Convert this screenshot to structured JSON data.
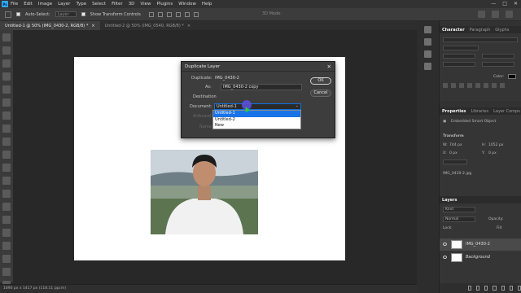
{
  "app": {
    "logo": "Ps"
  },
  "menu": [
    "File",
    "Edit",
    "Image",
    "Layer",
    "Type",
    "Select",
    "Filter",
    "3D",
    "View",
    "Plugins",
    "Window",
    "Help"
  ],
  "window_controls": [
    "—",
    "□",
    "✕"
  ],
  "options": {
    "auto_select_label": "Auto-Select:",
    "auto_select_value": "Layer",
    "show_transform_label": "Show Transform Controls",
    "mode_3d_label": "3D Mode:"
  },
  "tabs": [
    {
      "label": "Untitled-1 @ 50% (IMG_0430-2, RGB/8) *",
      "close": "×"
    },
    {
      "label": "Untitled-2 @ 50% (IMG_0540, RGB/8) *",
      "close": "×"
    }
  ],
  "status": {
    "text": "1890 px x 1417 px (118.11 ppcm)"
  },
  "dialog": {
    "title": "Duplicate Layer",
    "close": "✕",
    "duplicate_label": "Duplicate:",
    "duplicate_value": "IMG_0430-2",
    "as_label": "As:",
    "as_value": "IMG_0430-2 copy",
    "destination_label": "Destination",
    "document_label": "Document:",
    "document_value": "Untitled-1",
    "artboard_label": "Artboard:",
    "name_label": "Name:",
    "ok_label": "OK",
    "cancel_label": "Cancel",
    "document_options": [
      "Untitled-1",
      "Untitled-2",
      "New"
    ],
    "selected_option": "Untitled-1"
  },
  "right": {
    "character_tabs": [
      "Character",
      "Paragraph",
      "Glyphs"
    ],
    "color_label": "Color:",
    "properties_tabs": [
      "Properties",
      "Libraries",
      "Layer Comps"
    ],
    "smart_object_label": "Embedded Smart Object",
    "transform_label": "Transform",
    "w_label": "W:",
    "w_value": "744 px",
    "h_label": "H:",
    "h_value": "1052 px",
    "x_label": "X:",
    "x_value": "0 px",
    "y_label": "Y:",
    "y_value": "0 px",
    "file_label": "IMG_0430-2.jpg",
    "layers_tab": "Layers",
    "layers_kind": "Kind",
    "blend_mode": "Normal",
    "opacity_label": "Opacity:",
    "lock_label": "Lock:",
    "fill_label": "Fill:",
    "layers": [
      {
        "name": "IMG_0430-2",
        "italic": false
      },
      {
        "name": "Background",
        "italic": true
      }
    ]
  }
}
